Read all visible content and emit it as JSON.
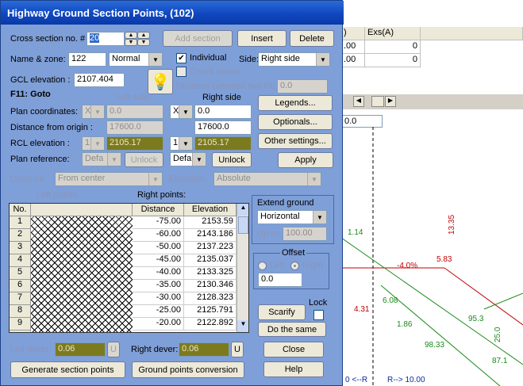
{
  "dialog": {
    "title": "Highway Ground Section Points, (102)",
    "cross_section_label": "Cross section no. #",
    "cross_section_value": "20",
    "add_section": "Add section",
    "insert": "Insert",
    "delete": "Delete",
    "name_zone_label": "Name & zone:",
    "name_value": "122",
    "zone_value": "Normal",
    "individual_label": "Individual",
    "individual_checked": true,
    "check_center_label": "Check center",
    "side_label": "Side:",
    "side_value": "Right side",
    "gcl_label": "GCL elevation :",
    "gcl_value": "2107.404",
    "distance_between_label": "Distance between two PL",
    "distance_between_value": "0.0",
    "f11_label": "F11: Goto",
    "left_side_header": "Left side",
    "right_side_header": "Right side",
    "plan_coordinates_label": "Plan coordinates:",
    "left_coord_sel": "X",
    "left_coord_val": "0.0",
    "right_coord_sel": "X",
    "right_coord_val": "0.0",
    "distance_origin_label": "Distance from origin :",
    "left_distance": "17600.0",
    "right_distance": "17600.0",
    "rcl_label": "RCL elevation :",
    "left_rcl_sel": "1",
    "left_rcl_val": "2105.17",
    "right_rcl_sel": "1",
    "right_rcl_val": "2105.17",
    "plan_reference_label": "Plan reference:",
    "left_ref": "Defa",
    "right_ref": "Defa",
    "unlock": "Unlock",
    "legends": "Legends...",
    "optionals": "Optionals...",
    "other_settings": "Other settings...",
    "apply": "Apply",
    "distance_label": "Distance",
    "distance_mode": "From center",
    "elevation_label": "Elevation",
    "elevation_mode": "Absolute",
    "left_points_label": "Left points:",
    "right_points_label": "Right points:",
    "extend_ground_label": "Extend ground",
    "extend_value": "Horizontal",
    "up_to_label": "Up to:",
    "up_to_value": "100.00",
    "offset_label": "Offset",
    "offset_left": "Left",
    "offset_right": "Right",
    "offset_value": "0.0",
    "scarify": "Scarify",
    "lock": "Lock",
    "do_the_same": "Do the same",
    "left_dever_label": "Left dever:",
    "left_dever_value": "0.06",
    "right_dever_label": "Right dever:",
    "right_dever_value": "0.06",
    "u_btn": "U",
    "close": "Close",
    "help": "Help",
    "generate": "Generate section points",
    "ground_conversion": "Ground points conversion"
  },
  "table": {
    "col_no": "No.",
    "col_distance": "Distance",
    "col_elevation": "Elevation",
    "rows": [
      {
        "no": "1",
        "distance": "-75.00",
        "elevation": "2153.59"
      },
      {
        "no": "2",
        "distance": "-60.00",
        "elevation": "2143.186"
      },
      {
        "no": "3",
        "distance": "-50.00",
        "elevation": "2137.223"
      },
      {
        "no": "4",
        "distance": "-45.00",
        "elevation": "2135.037"
      },
      {
        "no": "5",
        "distance": "-40.00",
        "elevation": "2133.325"
      },
      {
        "no": "6",
        "distance": "-35.00",
        "elevation": "2130.346"
      },
      {
        "no": "7",
        "distance": "-30.00",
        "elevation": "2128.323"
      },
      {
        "no": "8",
        "distance": "-25.00",
        "elevation": "2125.791"
      },
      {
        "no": "9",
        "distance": "-20.00",
        "elevation": "2122.892"
      }
    ]
  },
  "background": {
    "col1": ")",
    "col2": "Exs(A)",
    "r1a": ".00",
    "r1b": "0",
    "r2a": ".00",
    "r2b": "0",
    "field": "0.0",
    "axis_left": "0 <--R",
    "axis_right": "R--> 10.00",
    "percent": "-4.0%"
  },
  "colors": {
    "title": "#0a3aa8",
    "dialog": "#7f9fd8",
    "olive": "#7c7a1e"
  }
}
